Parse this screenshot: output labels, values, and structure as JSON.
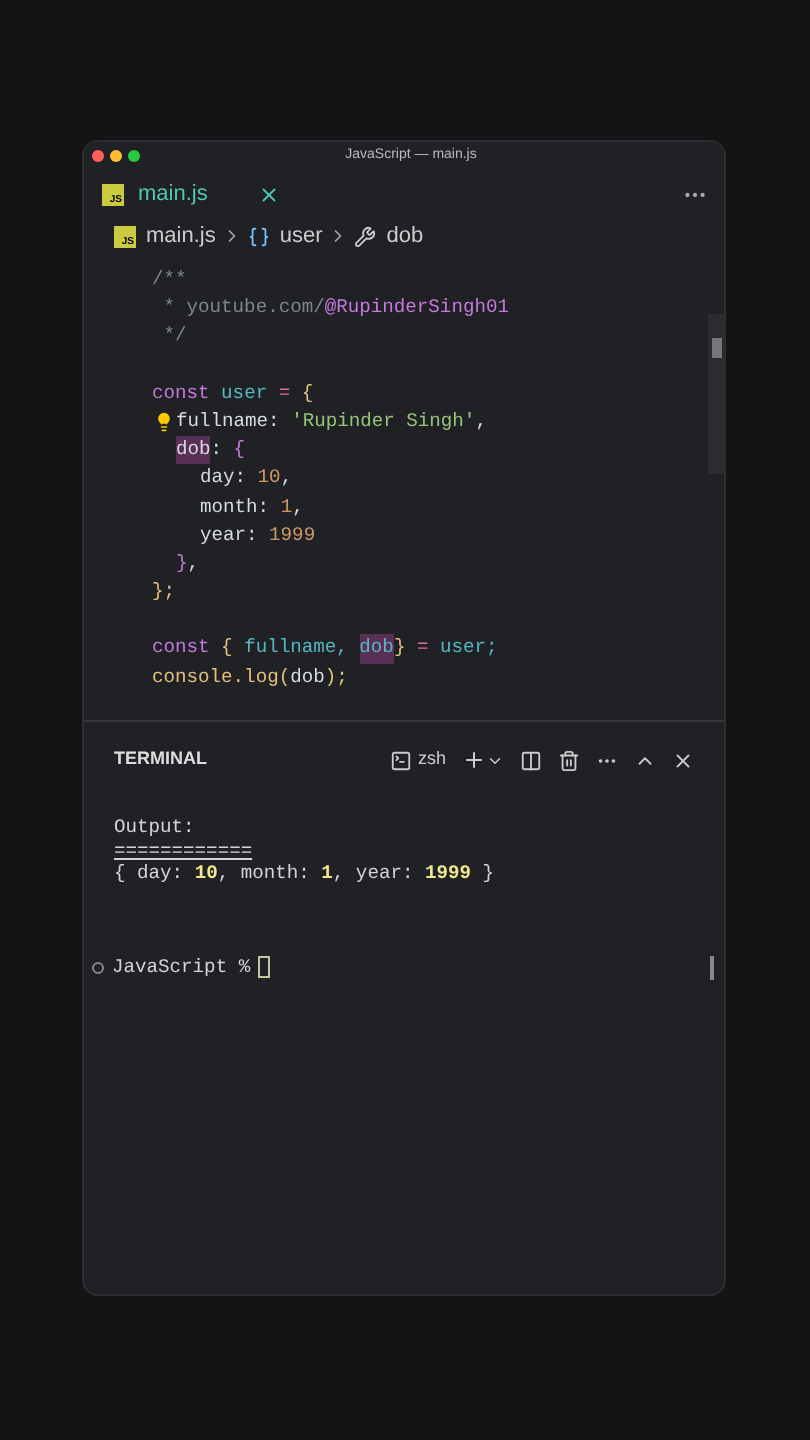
{
  "window": {
    "title": "JavaScript — main.js"
  },
  "tabs": [
    {
      "label": "main.js",
      "icon_text": "JS",
      "selected": true
    }
  ],
  "breadcrumb": [
    {
      "kind": "file",
      "icon_text": "JS",
      "label": "main.js"
    },
    {
      "kind": "variable",
      "label": "user"
    },
    {
      "kind": "property",
      "label": "dob"
    }
  ],
  "editor": {
    "blocks": [
      {
        "lines": [
          {
            "hint": false,
            "tokens": [
              {
                "text": "/**",
                "kind": "comment",
                "highlighted": false
              }
            ]
          },
          {
            "hint": false,
            "tokens": [
              {
                "text": " * youtube.com/",
                "kind": "comment",
                "highlighted": false
              },
              {
                "text": "@RupinderSingh01",
                "kind": "handle",
                "highlighted": false
              }
            ]
          },
          {
            "hint": false,
            "tokens": [
              {
                "text": " */",
                "kind": "comment",
                "highlighted": false
              }
            ]
          }
        ]
      },
      {
        "lines": [
          {
            "hint": false,
            "tokens": [
              {
                "text": "const",
                "kind": "keyword",
                "highlighted": false
              },
              {
                "text": " user",
                "kind": "variable",
                "highlighted": false
              },
              {
                "text": " = ",
                "kind": "operator",
                "highlighted": false
              },
              {
                "text": "{",
                "kind": "brace",
                "highlighted": false
              }
            ],
            "children": [
              {
                "hint": true,
                "tokens": [
                  {
                    "text": "fullname: ",
                    "kind": "property",
                    "highlighted": false
                  },
                  {
                    "text": "'Rupinder Singh'",
                    "kind": "string",
                    "highlighted": false
                  },
                  {
                    "text": ",",
                    "kind": "property",
                    "highlighted": false
                  }
                ]
              },
              {
                "hint": false,
                "tokens": [
                  {
                    "text": "dob",
                    "kind": "property",
                    "highlighted": true
                  },
                  {
                    "text": ": ",
                    "kind": "property",
                    "highlighted": false
                  },
                  {
                    "text": "{",
                    "kind": "brace2",
                    "highlighted": false
                  }
                ],
                "children": [
                  {
                    "hint": false,
                    "tokens": [
                      {
                        "text": "day: ",
                        "kind": "property",
                        "highlighted": false
                      },
                      {
                        "text": "10",
                        "kind": "number",
                        "highlighted": false
                      },
                      {
                        "text": ",",
                        "kind": "property",
                        "highlighted": false
                      }
                    ]
                  },
                  {
                    "hint": false,
                    "tokens": [
                      {
                        "text": "month: ",
                        "kind": "property",
                        "highlighted": false
                      },
                      {
                        "text": "1",
                        "kind": "number",
                        "highlighted": false
                      },
                      {
                        "text": ",",
                        "kind": "property",
                        "highlighted": false
                      }
                    ]
                  },
                  {
                    "hint": false,
                    "tokens": [
                      {
                        "text": "year: ",
                        "kind": "property",
                        "highlighted": false
                      },
                      {
                        "text": "1999",
                        "kind": "number",
                        "highlighted": false
                      }
                    ]
                  }
                ]
              },
              {
                "hint": false,
                "tokens": [
                  {
                    "text": "}",
                    "kind": "brace2",
                    "highlighted": false
                  },
                  {
                    "text": ",",
                    "kind": "property",
                    "highlighted": false
                  }
                ]
              }
            ]
          },
          {
            "hint": false,
            "tokens": [
              {
                "text": "};",
                "kind": "brace",
                "highlighted": false
              }
            ]
          }
        ]
      },
      {
        "lines": [
          {
            "hint": false,
            "tokens": [
              {
                "text": "const",
                "kind": "keyword",
                "highlighted": false
              },
              {
                "text": " {",
                "kind": "brace",
                "highlighted": false
              },
              {
                "text": " fullname, ",
                "kind": "variable",
                "highlighted": false
              },
              {
                "text": "dob",
                "kind": "variable",
                "highlighted": true
              },
              {
                "text": "}",
                "kind": "brace",
                "highlighted": false
              },
              {
                "text": " = ",
                "kind": "operator",
                "highlighted": false
              },
              {
                "text": "user;",
                "kind": "variable",
                "highlighted": false
              }
            ]
          },
          {
            "hint": false,
            "tokens": [
              {
                "text": "console.log(",
                "kind": "function",
                "highlighted": false
              },
              {
                "text": "dob",
                "kind": "property",
                "highlighted": false
              },
              {
                "text": ");",
                "kind": "function",
                "highlighted": false
              }
            ]
          }
        ]
      }
    ]
  },
  "terminal": {
    "title": "TERMINAL",
    "shell": "zsh",
    "output": [
      [
        {
          "text": "Output:",
          "kind": "plain"
        }
      ],
      [
        {
          "text": "============",
          "kind": "rule"
        }
      ],
      [
        {
          "text": "{ day: ",
          "kind": "plain"
        },
        {
          "text": "10",
          "kind": "number"
        },
        {
          "text": ", month: ",
          "kind": "plain"
        },
        {
          "text": "1",
          "kind": "number"
        },
        {
          "text": ", year: ",
          "kind": "plain"
        },
        {
          "text": "1999",
          "kind": "number"
        },
        {
          "text": " }",
          "kind": "plain"
        }
      ]
    ],
    "prompt": "JavaScript %"
  }
}
